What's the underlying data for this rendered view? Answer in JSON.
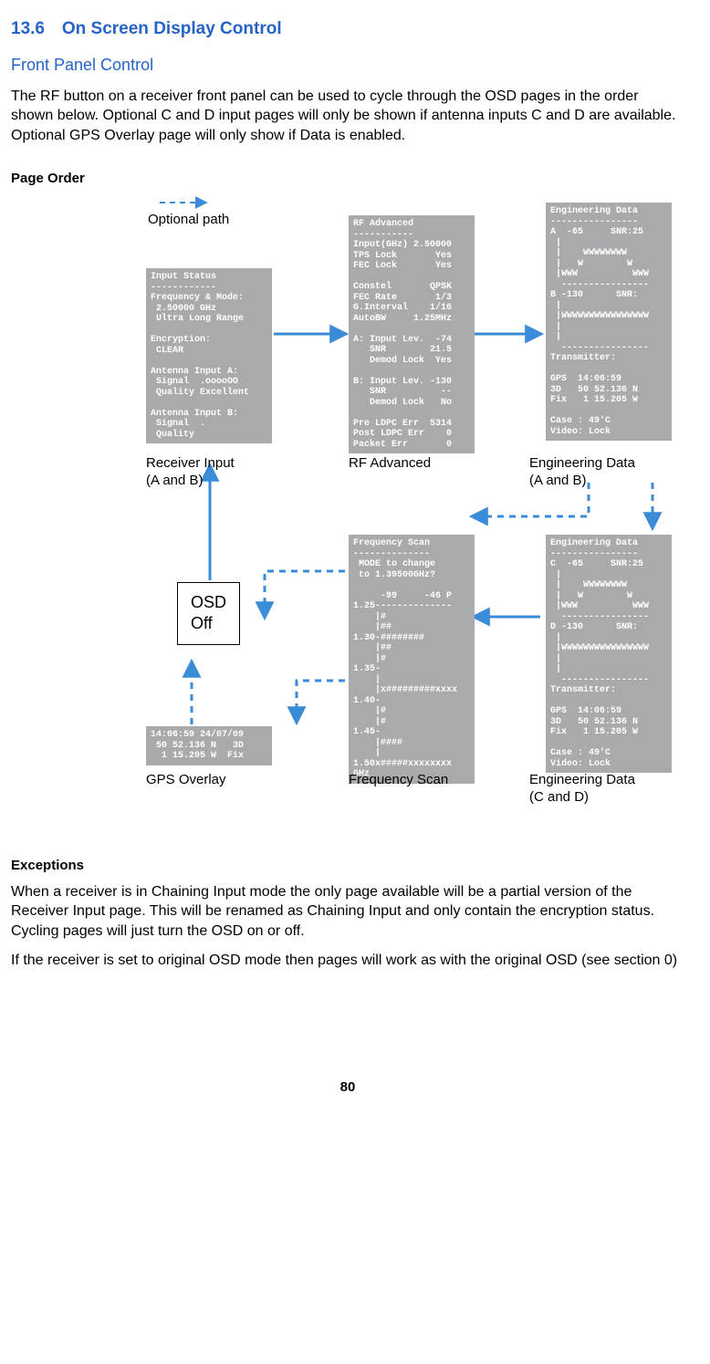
{
  "section": {
    "number": "13.6",
    "title": "On Screen Display Control"
  },
  "subheader": "Front Panel Control",
  "intro": "The RF button on a receiver front panel can be used to cycle through the OSD pages in the order shown below. Optional C and D input pages will only be shown if antenna inputs C and D are available. Optional GPS Overlay page will only show if Data is enabled.",
  "page_order_label": "Page Order",
  "optional_path_label": "Optional path",
  "captions": {
    "receiver_input": "Receiver Input\n(A and B)",
    "rf_advanced": "RF Advanced",
    "eng_ab": "Engineering Data\n(A and B)",
    "gps": "GPS Overlay",
    "freq_scan": "Frequency Scan",
    "eng_cd": "Engineering Data\n(C and D)"
  },
  "osd_off": "OSD\nOff",
  "boxes": {
    "input_status": "Input Status\n------------\nFrequency & Mode:\n 2.50000 GHz\n Ultra Long Range\n\nEncryption:\n CLEAR\n\nAntenna Input A:\n Signal  .ooooOO\n Quality Excellent\n\nAntenna Input B:\n Signal  .\n Quality",
    "rf_advanced": "RF Advanced\n-----------\nInput(GHz) 2.50000\nTPS Lock       Yes\nFEC Lock       Yes\n\nConstel       QPSK\nFEC Rate       1/3\nG.Interval    1/16\nAutoBW     1.25MHz\n\nA: Input Lev.  -74\n   SNR        21.5\n   Demod Lock  Yes\n\nB: Input Lev. -130\n   SNR          --\n   Demod Lock   No\n\nPre LDPC Err  5314\nPost LDPC Err    0\nPacket Err       0",
    "eng_ab": "Engineering Data\n----------------\nA  -65     SNR:25\n |\n |    WWWWWWWW\n |   W        W\n |WWW          WWW\n  ----------------\nB -130      SNR:\n |\n |WWWWWWWWWWWWWWWW\n |\n |\n  ----------------\nTransmitter:\n\nGPS  14:06:59\n3D   50 52.136 N\nFix   1 15.205 W\n\nCase : 49'C\nVideo: Lock",
    "eng_cd": "Engineering Data\n----------------\nC  -65     SNR:25\n |\n |    WWWWWWWW\n |   W        W\n |WWW          WWW\n  ----------------\nD -130      SNR:\n |\n |WWWWWWWWWWWWWWWW\n |\n |\n  ----------------\nTransmitter:\n\nGPS  14:06:59\n3D   50 52.136 N\nFix   1 15.205 W\n\nCase : 49'C\nVideo: Lock",
    "freq_scan": "Frequency Scan\n--------------\n MODE to change\n to 1.39500GHz?\n\n     -99     -46 P\n1.25--------------\n    |#\n    |##\n1.30-########\n    |##\n    |#\n1.35-\n    |\n    |x#########xxxx\n1.40-\n    |#\n    |#\n1.45-\n    |####\n    |\n1.50x#####xxxxxxxx\nGHz",
    "gps": "14:06:59 24/07/09\n 50 52.136 N   3D\n  1 15.205 W  Fix"
  },
  "exceptions_label": "Exceptions",
  "exceptions_p1": "When a receiver is in Chaining Input mode the only page available will be a partial version of the Receiver Input page. This will be renamed as Chaining Input and only contain the encryption status. Cycling pages will just turn the OSD on or off.",
  "exceptions_p2": "If the receiver is set to original OSD mode then pages will work as with the original OSD (see section 0)",
  "page_number": "80"
}
